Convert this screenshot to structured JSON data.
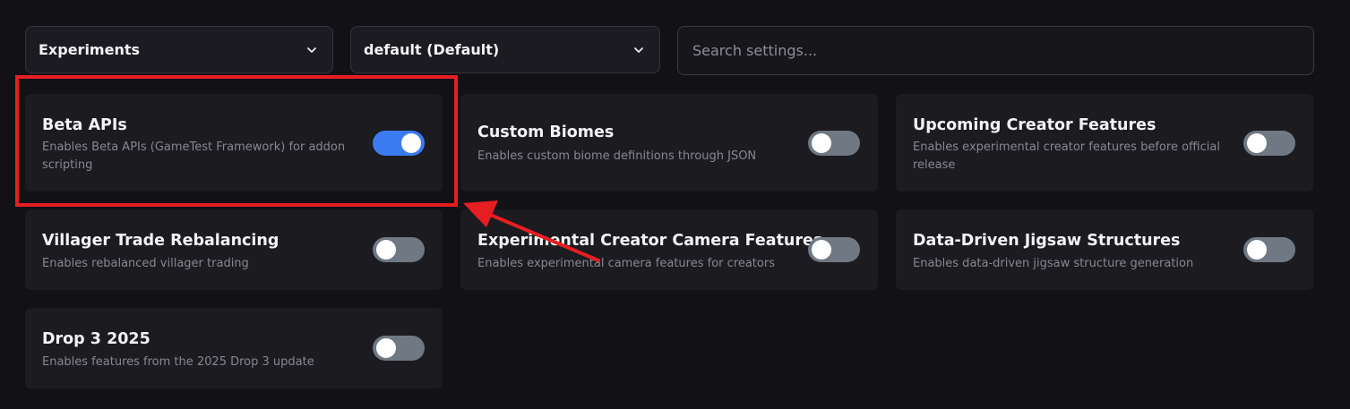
{
  "filters": {
    "category_label": "Experiments",
    "profile_label": "default (Default)",
    "search_placeholder": "Search settings...",
    "search_value": ""
  },
  "settings": [
    {
      "title": "Beta APIs",
      "description": "Enables Beta APIs (GameTest Framework) for addon scripting",
      "enabled": true
    },
    {
      "title": "Custom Biomes",
      "description": "Enables custom biome definitions through JSON",
      "enabled": false
    },
    {
      "title": "Upcoming Creator Features",
      "description": "Enables experimental creator features before official release",
      "enabled": false
    },
    {
      "title": "Villager Trade Rebalancing",
      "description": "Enables rebalanced villager trading",
      "enabled": false
    },
    {
      "title": "Experimental Creator Camera Features",
      "description": "Enables experimental camera features for creators",
      "enabled": false
    },
    {
      "title": "Data-Driven Jigsaw Structures",
      "description": "Enables data-driven jigsaw structure generation",
      "enabled": false
    },
    {
      "title": "Drop 3 2025",
      "description": "Enables features from the 2025 Drop 3 update",
      "enabled": false
    }
  ],
  "colors": {
    "toggle_on": "#3b7bf2",
    "toggle_off": "#6f7883",
    "annotation": "#e61e22"
  }
}
